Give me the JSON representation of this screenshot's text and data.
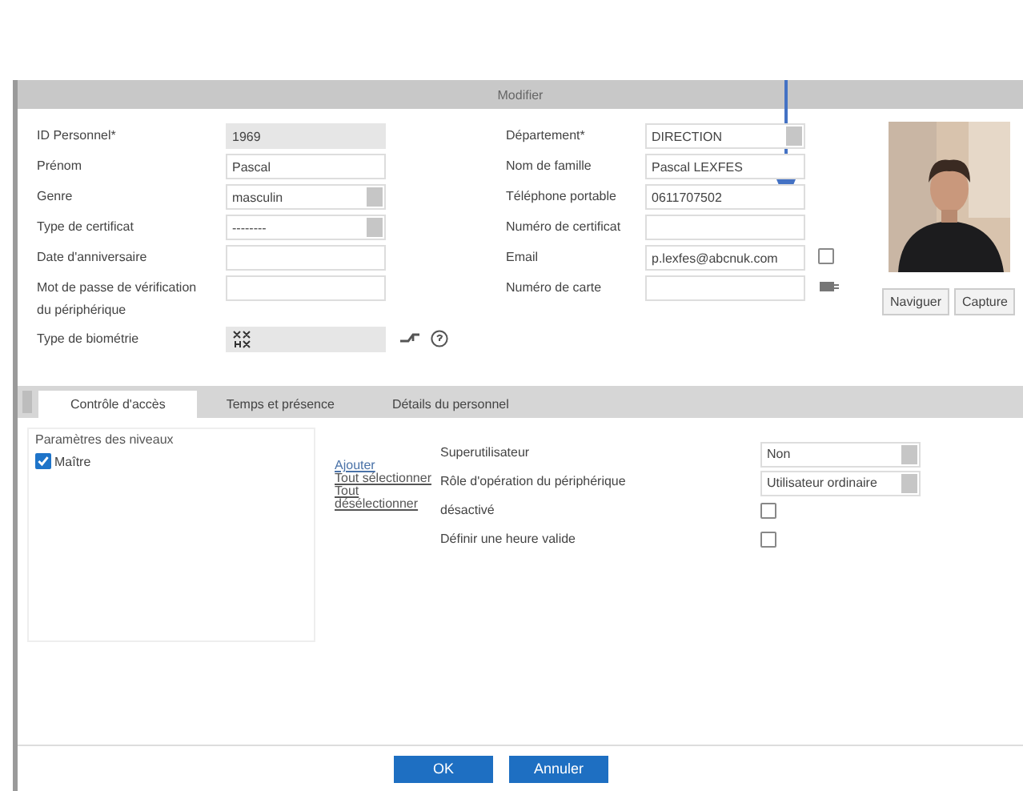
{
  "window": {
    "title": "Modifier"
  },
  "form_left": [
    {
      "label": "ID Personnel*",
      "kind": "readonly",
      "value": "1969"
    },
    {
      "label": "Prénom",
      "kind": "text",
      "value": "Pascal"
    },
    {
      "label": "Genre",
      "kind": "select",
      "value": "masculin"
    },
    {
      "label": "Type de certificat",
      "kind": "select",
      "value": "--------"
    },
    {
      "label": "Date d'anniversaire",
      "kind": "text"
    },
    {
      "label": "Mot de passe de vérification du périphérique",
      "kind": "text"
    },
    {
      "label": "Type de biométrie",
      "kind": "biometric"
    }
  ],
  "form_right": [
    {
      "label": "Département*",
      "kind": "select",
      "value": "DIRECTION"
    },
    {
      "label": "Nom de famille",
      "kind": "text",
      "value": "Pascal LEXFES"
    },
    {
      "label": "Téléphone portable",
      "kind": "text",
      "value": "0611707502"
    },
    {
      "label": "Numéro de certificat",
      "kind": "text"
    },
    {
      "label": "Email",
      "kind": "text_checkbox",
      "value": "p.lexfes@abcnuk.com",
      "checked": false
    },
    {
      "label": "Numéro de carte",
      "kind": "text_card"
    }
  ],
  "photo_buttons": [
    "Naviguer",
    "Capture"
  ],
  "tabs": [
    {
      "label": "Contrôle d'accès",
      "selected": true
    },
    {
      "label": "Temps et présence",
      "selected": false
    },
    {
      "label": "Détails du personnel",
      "selected": false
    }
  ],
  "levels": {
    "legend": "Paramètres des niveaux",
    "items": [
      {
        "label": "Maître",
        "checked": true
      }
    ]
  },
  "links": [
    "Ajouter",
    "Tout sélectionner",
    "Tout désélectionner"
  ],
  "settings": [
    {
      "label": "Superutilisateur",
      "kind": "select",
      "value": "Non"
    },
    {
      "label": "Rôle d'opération du périphérique",
      "kind": "select",
      "value": "Utilisateur ordinaire"
    },
    {
      "label": "désactivé",
      "kind": "checkbox",
      "checked": false
    },
    {
      "label": "Définir une heure valide",
      "kind": "checkbox",
      "checked": false
    }
  ],
  "buttons": [
    "OK",
    "Annuler"
  ]
}
